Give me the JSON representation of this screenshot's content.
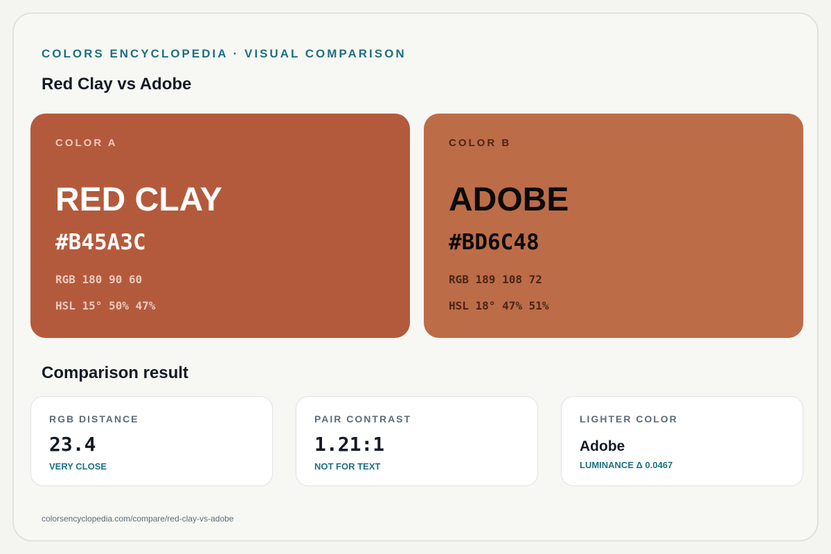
{
  "header": {
    "eyebrow": "Colors Encyclopedia · Visual Comparison",
    "title": "Red Clay vs Adobe"
  },
  "colors": {
    "a": {
      "label": "Color A",
      "name": "Red Clay",
      "hex": "#B45A3C",
      "rgb": "RGB 180 90 60",
      "hsl": "HSL 15° 50% 47%",
      "swatch_color": "#B45A3C"
    },
    "b": {
      "label": "Color B",
      "name": "Adobe",
      "hex": "#BD6C48",
      "rgb": "RGB 189 108 72",
      "hsl": "HSL 18° 47% 51%",
      "swatch_color": "#BD6C48"
    }
  },
  "comparison": {
    "title": "Comparison result",
    "metrics": [
      {
        "label": "RGB Distance",
        "value": "23.4",
        "sub": "Very close"
      },
      {
        "label": "Pair Contrast",
        "value": "1.21:1",
        "sub": "Not for text"
      },
      {
        "label": "Lighter Color",
        "value": "Adobe",
        "sub": "Luminance Δ 0.0467"
      }
    ]
  },
  "footer": {
    "url": "colorsencyclopedia.com/compare/red-clay-vs-adobe"
  },
  "theme": {
    "accent": "#1e7080",
    "background": "#f7f7f3"
  }
}
